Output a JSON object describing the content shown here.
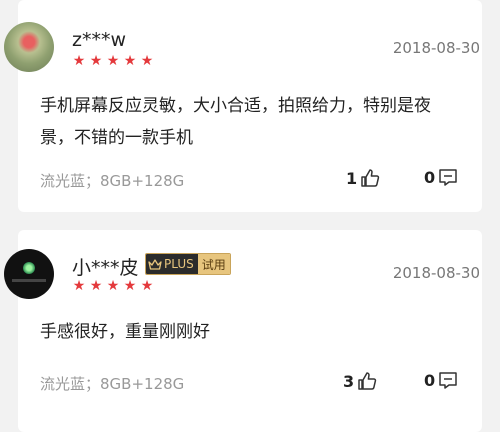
{
  "reviews": [
    {
      "username": "z***w",
      "badge": null,
      "rating": 5,
      "date": "2018-08-30",
      "comment": "手机屏幕反应灵敏，大小合适，拍照给力，特别是夜景，不错的一款手机",
      "spec": "流光蓝；8GB+128G",
      "likes": "1",
      "replies": "0"
    },
    {
      "username": "小***皮",
      "badge": {
        "plus_label": "PLUS",
        "trial_label": "试用"
      },
      "rating": 5,
      "date": "2018-08-30",
      "comment": "手感很好，重量刚刚好",
      "spec": "流光蓝；8GB+128G",
      "likes": "3",
      "replies": "0"
    }
  ],
  "colors": {
    "star": "#e4393c",
    "badge_gold": "#e7c57e",
    "badge_dark": "#2b2b2b"
  }
}
